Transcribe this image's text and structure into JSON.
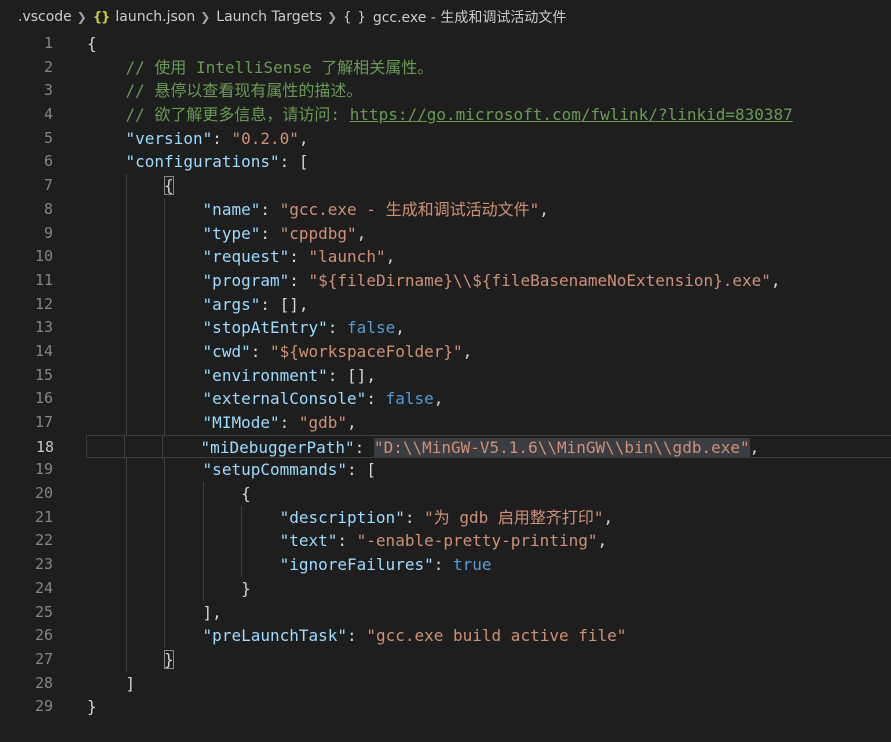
{
  "breadcrumb": [
    {
      "label": ".vscode",
      "icon": ""
    },
    {
      "label": "launch.json",
      "icon": "json-braces-icon"
    },
    {
      "label": "Launch Targets",
      "icon": ""
    },
    {
      "label": "gcc.exe - 生成和调试活动文件",
      "icon": "object-braces-icon"
    }
  ],
  "breadcrumb_icons": {
    "json": "{}",
    "object": "{ }"
  },
  "colors": {
    "background": "#1e1e1e",
    "key": "#9cdcfe",
    "string": "#ce9178",
    "comment": "#6a9955",
    "boolean": "#569cd6",
    "punctuation": "#d4d4d4",
    "line_number": "#858585"
  },
  "editor": {
    "active_line": 18,
    "lines": [
      {
        "n": "1",
        "indent": 0,
        "tokens": [
          [
            "p",
            "{"
          ]
        ]
      },
      {
        "n": "2",
        "indent": 1,
        "tokens": [
          [
            "c",
            "// 使用 IntelliSense 了解相关属性。"
          ]
        ]
      },
      {
        "n": "3",
        "indent": 1,
        "tokens": [
          [
            "c",
            "// 悬停以查看现有属性的描述。"
          ]
        ]
      },
      {
        "n": "4",
        "indent": 1,
        "tokens": [
          [
            "c",
            "// 欲了解更多信息，请访问: "
          ],
          [
            "u",
            "https://go.microsoft.com/fwlink/?linkid=830387"
          ]
        ]
      },
      {
        "n": "5",
        "indent": 1,
        "tokens": [
          [
            "k",
            "\"version\""
          ],
          [
            "p",
            ": "
          ],
          [
            "s",
            "\"0.2.0\""
          ],
          [
            "p",
            ","
          ]
        ]
      },
      {
        "n": "6",
        "indent": 1,
        "tokens": [
          [
            "k",
            "\"configurations\""
          ],
          [
            "p",
            ": ["
          ]
        ]
      },
      {
        "n": "7",
        "indent": 2,
        "tokens": [
          [
            "ph",
            "{"
          ]
        ]
      },
      {
        "n": "8",
        "indent": 3,
        "tokens": [
          [
            "k",
            "\"name\""
          ],
          [
            "p",
            ": "
          ],
          [
            "s",
            "\"gcc.exe - 生成和调试活动文件\""
          ],
          [
            "p",
            ","
          ]
        ]
      },
      {
        "n": "9",
        "indent": 3,
        "tokens": [
          [
            "k",
            "\"type\""
          ],
          [
            "p",
            ": "
          ],
          [
            "s",
            "\"cppdbg\""
          ],
          [
            "p",
            ","
          ]
        ]
      },
      {
        "n": "10",
        "indent": 3,
        "tokens": [
          [
            "k",
            "\"request\""
          ],
          [
            "p",
            ": "
          ],
          [
            "s",
            "\"launch\""
          ],
          [
            "p",
            ","
          ]
        ]
      },
      {
        "n": "11",
        "indent": 3,
        "tokens": [
          [
            "k",
            "\"program\""
          ],
          [
            "p",
            ": "
          ],
          [
            "s",
            "\"${fileDirname}\\\\${fileBasenameNoExtension}.exe\""
          ],
          [
            "p",
            ","
          ]
        ]
      },
      {
        "n": "12",
        "indent": 3,
        "tokens": [
          [
            "k",
            "\"args\""
          ],
          [
            "p",
            ": [],"
          ]
        ]
      },
      {
        "n": "13",
        "indent": 3,
        "tokens": [
          [
            "k",
            "\"stopAtEntry\""
          ],
          [
            "p",
            ": "
          ],
          [
            "b",
            "false"
          ],
          [
            "p",
            ","
          ]
        ]
      },
      {
        "n": "14",
        "indent": 3,
        "tokens": [
          [
            "k",
            "\"cwd\""
          ],
          [
            "p",
            ": "
          ],
          [
            "s",
            "\"${workspaceFolder}\""
          ],
          [
            "p",
            ","
          ]
        ]
      },
      {
        "n": "15",
        "indent": 3,
        "tokens": [
          [
            "k",
            "\"environment\""
          ],
          [
            "p",
            ": [],"
          ]
        ]
      },
      {
        "n": "16",
        "indent": 3,
        "tokens": [
          [
            "k",
            "\"externalConsole\""
          ],
          [
            "p",
            ": "
          ],
          [
            "b",
            "false"
          ],
          [
            "p",
            ","
          ]
        ]
      },
      {
        "n": "17",
        "indent": 3,
        "tokens": [
          [
            "k",
            "\"MIMode\""
          ],
          [
            "p",
            ": "
          ],
          [
            "s",
            "\"gdb\""
          ],
          [
            "p",
            ","
          ]
        ]
      },
      {
        "n": "18",
        "indent": 3,
        "tokens": [
          [
            "k",
            "\"miDebuggerPath\""
          ],
          [
            "p",
            ": "
          ],
          [
            "ss",
            "\"D:\\\\MinGW-V5.1.6\\\\MinGW\\\\bin\\\\gdb.exe\""
          ],
          [
            "p",
            ","
          ]
        ]
      },
      {
        "n": "19",
        "indent": 3,
        "tokens": [
          [
            "k",
            "\"setupCommands\""
          ],
          [
            "p",
            ": ["
          ]
        ]
      },
      {
        "n": "20",
        "indent": 4,
        "tokens": [
          [
            "p",
            "{"
          ]
        ]
      },
      {
        "n": "21",
        "indent": 5,
        "tokens": [
          [
            "k",
            "\"description\""
          ],
          [
            "p",
            ": "
          ],
          [
            "s",
            "\"为 gdb 启用整齐打印\""
          ],
          [
            "p",
            ","
          ]
        ]
      },
      {
        "n": "22",
        "indent": 5,
        "tokens": [
          [
            "k",
            "\"text\""
          ],
          [
            "p",
            ": "
          ],
          [
            "s",
            "\"-enable-pretty-printing\""
          ],
          [
            "p",
            ","
          ]
        ]
      },
      {
        "n": "23",
        "indent": 5,
        "tokens": [
          [
            "k",
            "\"ignoreFailures\""
          ],
          [
            "p",
            ": "
          ],
          [
            "b",
            "true"
          ]
        ]
      },
      {
        "n": "24",
        "indent": 4,
        "tokens": [
          [
            "p",
            "}"
          ]
        ]
      },
      {
        "n": "25",
        "indent": 3,
        "tokens": [
          [
            "p",
            "],"
          ]
        ]
      },
      {
        "n": "26",
        "indent": 3,
        "tokens": [
          [
            "k",
            "\"preLaunchTask\""
          ],
          [
            "p",
            ": "
          ],
          [
            "s",
            "\"gcc.exe build active file\""
          ]
        ]
      },
      {
        "n": "27",
        "indent": 2,
        "tokens": [
          [
            "ph",
            "}"
          ]
        ]
      },
      {
        "n": "28",
        "indent": 1,
        "tokens": [
          [
            "p",
            "]"
          ]
        ]
      },
      {
        "n": "29",
        "indent": 0,
        "tokens": [
          [
            "p",
            "}"
          ]
        ]
      }
    ]
  }
}
